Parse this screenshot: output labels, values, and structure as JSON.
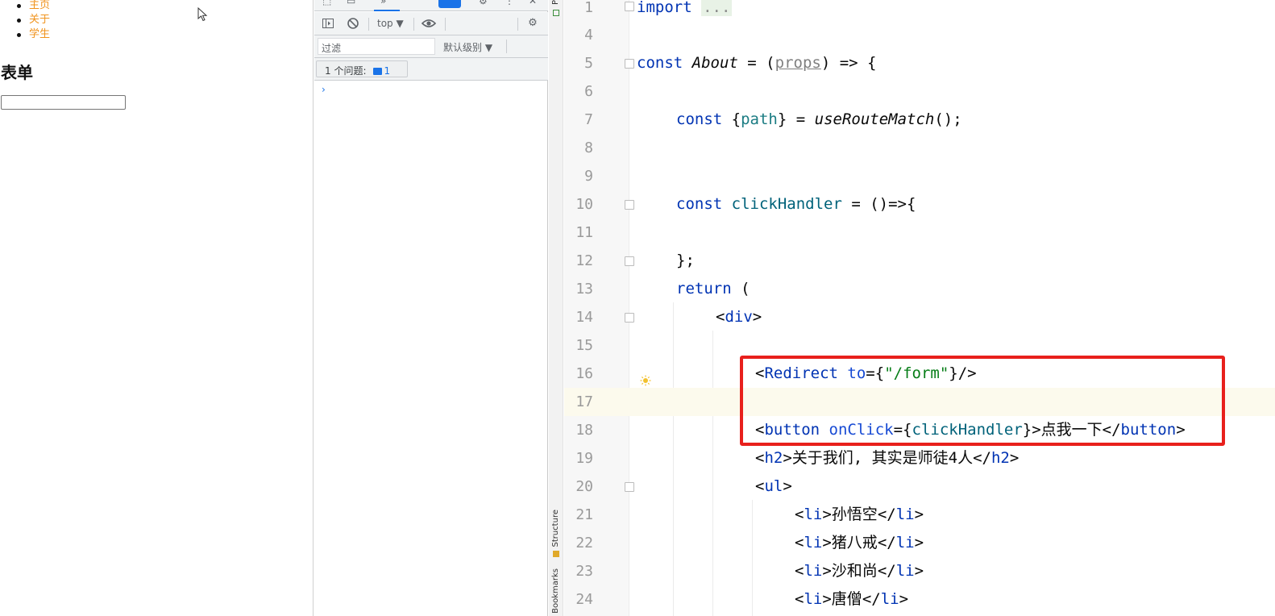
{
  "browser_page": {
    "nav_items": [
      "主页",
      "关于",
      "学生"
    ],
    "form_title": "表单",
    "form_input_value": ""
  },
  "devtools": {
    "context_selector": "top ▼",
    "filter_placeholder": "过滤",
    "level_selector": "默认级别 ▼",
    "issues_label": "1 个问题:",
    "issues_count": "1",
    "prompt": "›",
    "accent_color": "#1a73e8"
  },
  "ide": {
    "side_labels": {
      "structure": "Structure",
      "bookmarks": "Bookmarks",
      "top": "P"
    },
    "lines": [
      {
        "num": "1"
      },
      {
        "num": "4"
      },
      {
        "num": "5"
      },
      {
        "num": "6"
      },
      {
        "num": "7"
      },
      {
        "num": "8"
      },
      {
        "num": "9"
      },
      {
        "num": "10"
      },
      {
        "num": "11"
      },
      {
        "num": "12"
      },
      {
        "num": "13"
      },
      {
        "num": "14"
      },
      {
        "num": "15"
      },
      {
        "num": "16"
      },
      {
        "num": "17"
      },
      {
        "num": "18"
      },
      {
        "num": "19"
      },
      {
        "num": "20"
      },
      {
        "num": "21"
      },
      {
        "num": "22"
      },
      {
        "num": "23"
      },
      {
        "num": "24"
      }
    ],
    "code": {
      "l1_kw": "import",
      "l1_fold": "...",
      "l5_kw": "const",
      "l5_name": "About",
      "l5_eq": " = (",
      "l5_param": "props",
      "l5_end": ") => {",
      "l7_kw": "const",
      "l7_open": " {",
      "l7_var": "path",
      "l7_mid": "} = ",
      "l7_fn": "useRouteMatch",
      "l7_end": "();",
      "l10_kw": "const",
      "l10_name": " clickHandler",
      "l10_end": " = ()=>{",
      "l12": "};",
      "l13_kw": "return",
      "l13_end": " (",
      "l14_open": "<",
      "l14_tag": "div",
      "l14_close": ">",
      "l16_open": "<",
      "l16_tag": "Redirect",
      "l16_attr": " to",
      "l16_eq": "={",
      "l16_str": "\"/form\"",
      "l16_end": "}/>",
      "l18_open": "<",
      "l18_tag": "button",
      "l18_attr": " onClick",
      "l18_eq": "={",
      "l18_var": "clickHandler",
      "l18_mid": "}>点我一下</",
      "l18_tag2": "button",
      "l18_close": ">",
      "l19_open": "<",
      "l19_tag": "h2",
      "l19_mid": ">关于我们, 其实是师徒4人</",
      "l19_tag2": "h2",
      "l19_close": ">",
      "l20_open": "<",
      "l20_tag": "ul",
      "l20_close": ">",
      "l21_text": "孙悟空",
      "l22_text": "猪八戒",
      "l23_text": "沙和尚",
      "l24_text": "唐僧",
      "li_tag": "li"
    },
    "highlight_color": "#e8201c"
  }
}
